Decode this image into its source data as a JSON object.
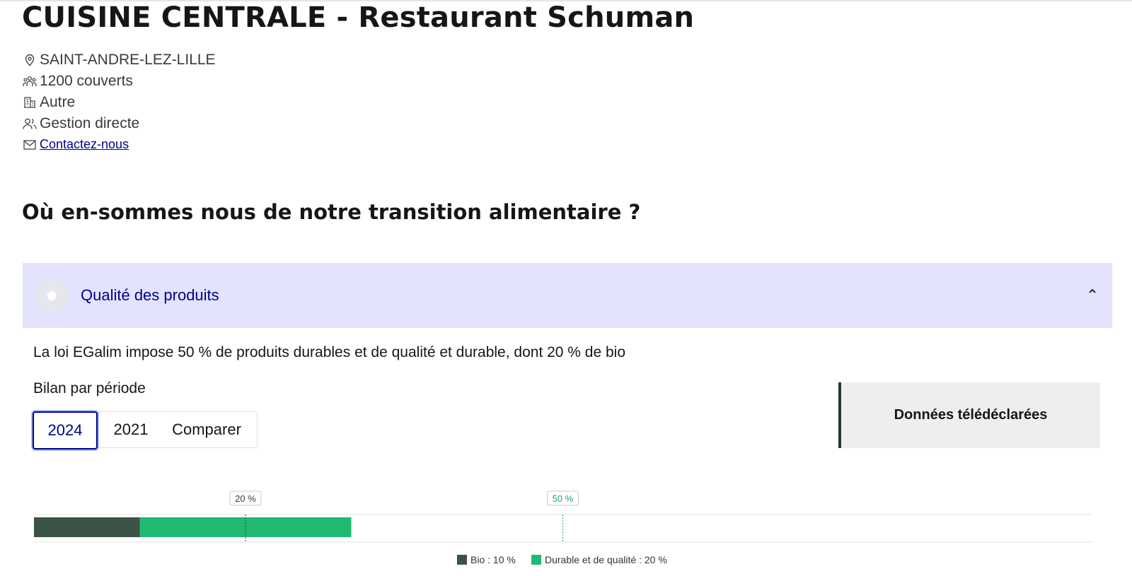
{
  "header": {
    "title": "CUISINE CENTRALE - Restaurant Schuman"
  },
  "info": {
    "location": "SAINT-ANDRE-LEZ-LILLE",
    "covers": "1200 couverts",
    "sector": "Autre",
    "management": "Gestion directe",
    "contact": " Contactez-nous"
  },
  "section": {
    "title": "Où en-sommes nous de notre transition alimentaire ?"
  },
  "accordion": {
    "label": "Qualité des produits"
  },
  "content": {
    "law_text": "La loi EGalim impose 50 % de produits durables et de qualité et durable, dont 20 % de bio",
    "period_label": "Bilan par période",
    "tabs": [
      "2024",
      "2021",
      "Comparer"
    ],
    "selected_tab": "2024",
    "callout": "Données télédéclarées"
  },
  "colors": {
    "bio": "#3e5347",
    "durable": "#21b874",
    "accent": "#000091",
    "accordion_bg": "#e3e3fd"
  },
  "chart_data": {
    "type": "bar",
    "orientation": "horizontal-stacked",
    "xlim": [
      0,
      100
    ],
    "series": [
      {
        "name": "Bio",
        "value": 10
      },
      {
        "name": "Durable et de qualité",
        "value": 20
      }
    ],
    "thresholds": [
      {
        "label": "20 %",
        "value": 20
      },
      {
        "label": "50 %",
        "value": 50
      }
    ],
    "legend": [
      "Bio : 10 %",
      "Durable et de qualité : 20 %"
    ]
  }
}
